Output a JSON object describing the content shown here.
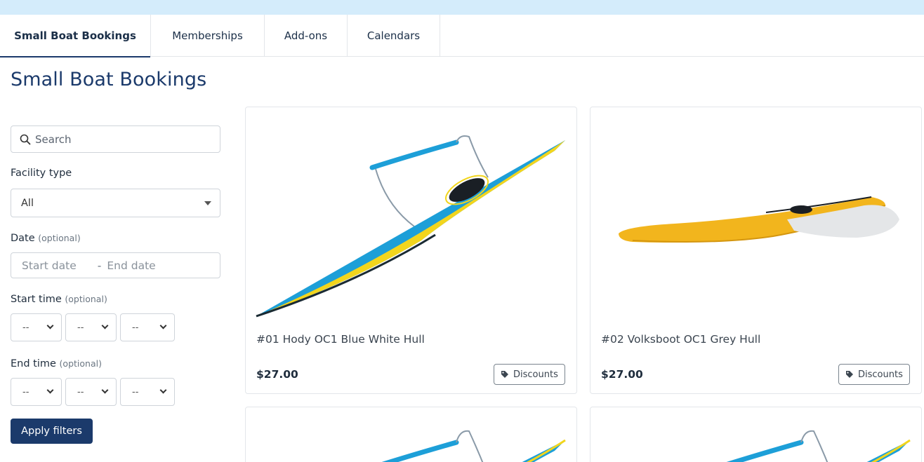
{
  "tabs": [
    {
      "label": "Small Boat Bookings",
      "active": true
    },
    {
      "label": "Memberships"
    },
    {
      "label": "Add-ons"
    },
    {
      "label": "Calendars"
    }
  ],
  "page_title": "Small Boat Bookings",
  "filters": {
    "search_placeholder": "Search",
    "facility_label": "Facility type",
    "facility_value": "All",
    "date_label": "Date",
    "optional": "(optional)",
    "start_date_placeholder": "Start date",
    "date_sep": "-",
    "end_date_placeholder": "End date",
    "start_time_label": "Start time",
    "end_time_label": "End time",
    "time_placeholder": "--",
    "apply_label": "Apply filters"
  },
  "cards": [
    {
      "title": "#01 Hody OC1 Blue White Hull",
      "price": "$27.00",
      "discounts_label": "Discounts",
      "boat_color": "blue"
    },
    {
      "title": "#02 Volksboot OC1 Grey Hull",
      "price": "$27.00",
      "discounts_label": "Discounts",
      "boat_color": "yellow"
    },
    {
      "boat_color": "blue"
    },
    {
      "boat_color": "blue"
    }
  ],
  "colors": {
    "accent": "#1b3a6b",
    "top_strip": "#d4ecfb",
    "boat_blue": "#1d9fd8",
    "boat_yellow": "#f2b51d"
  }
}
